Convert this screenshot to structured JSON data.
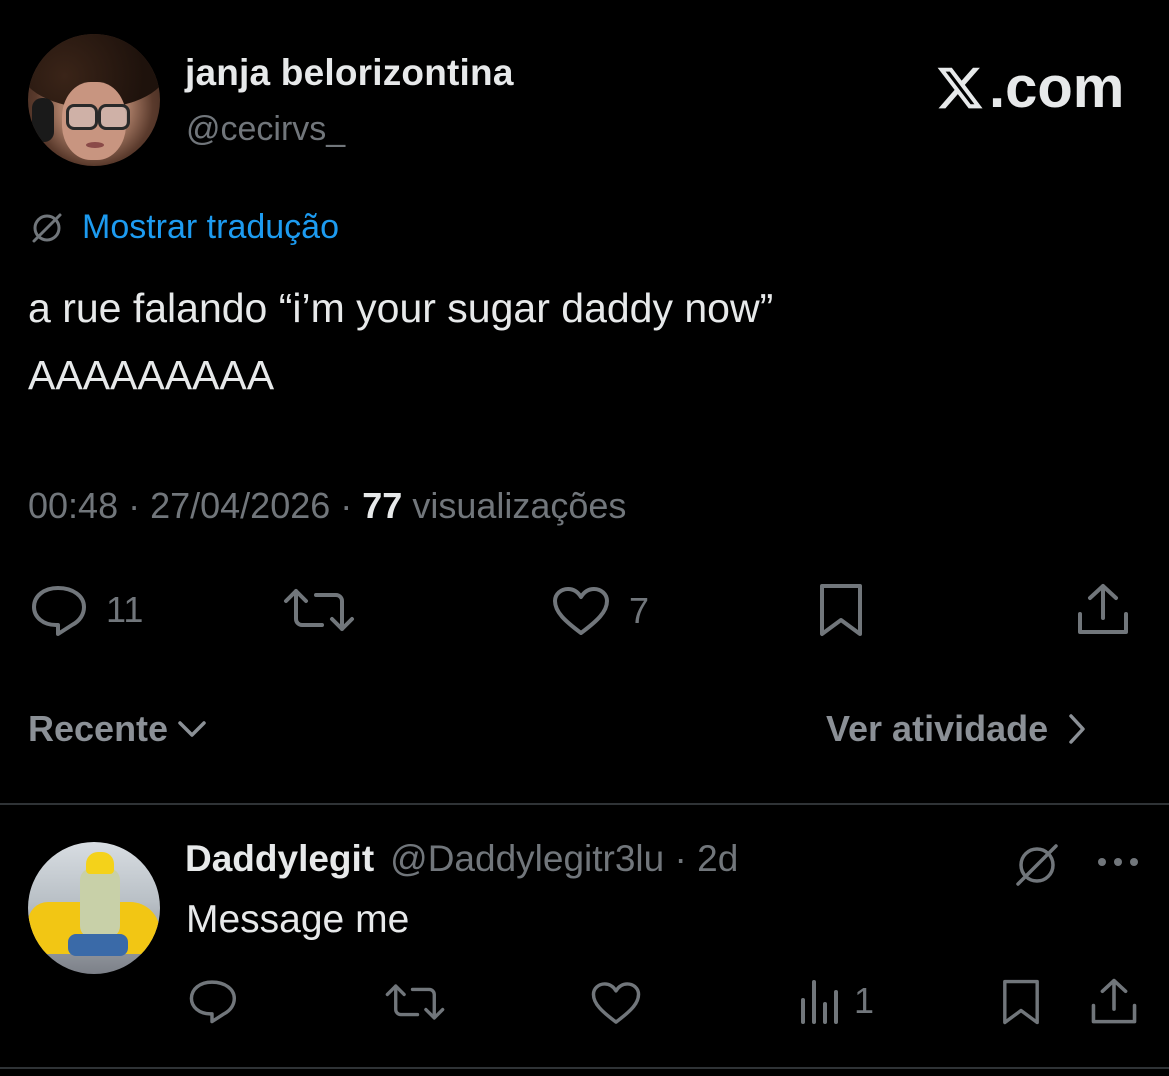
{
  "tweet": {
    "author": {
      "display_name": "janja belorizontina",
      "handle": "@cecirvs_"
    },
    "brand": {
      "label": ".com"
    },
    "translate_label": "Mostrar tradução",
    "text_line1": "a rue falando “i’m your sugar daddy now”",
    "text_line2": "AAAAAAAAA",
    "time": "00:48",
    "separator": " · ",
    "date": "27/04/2026",
    "views_count": "77",
    "views_label": " visualizações",
    "actions": {
      "reply_count": "11",
      "like_count": "7"
    }
  },
  "replies_bar": {
    "sort_label": "Recente",
    "activity_label": "Ver atividade"
  },
  "reply": {
    "display_name": "Daddylegit",
    "handle": "@Daddylegitr3lu",
    "separator": " · ",
    "age": "2d",
    "text": "Message me",
    "views_count": "1"
  },
  "colors": {
    "background": "#000000",
    "text": "#e7e9ea",
    "muted": "#71767b",
    "accent": "#1d9bf0",
    "divider": "#2f3336"
  },
  "icons": [
    "x-logo-icon",
    "translate-icon",
    "reply-icon",
    "retweet-icon",
    "like-icon",
    "bookmark-icon",
    "share-icon",
    "chevron-down-icon",
    "chevron-right-icon",
    "grok-icon",
    "more-icon",
    "views-icon"
  ]
}
